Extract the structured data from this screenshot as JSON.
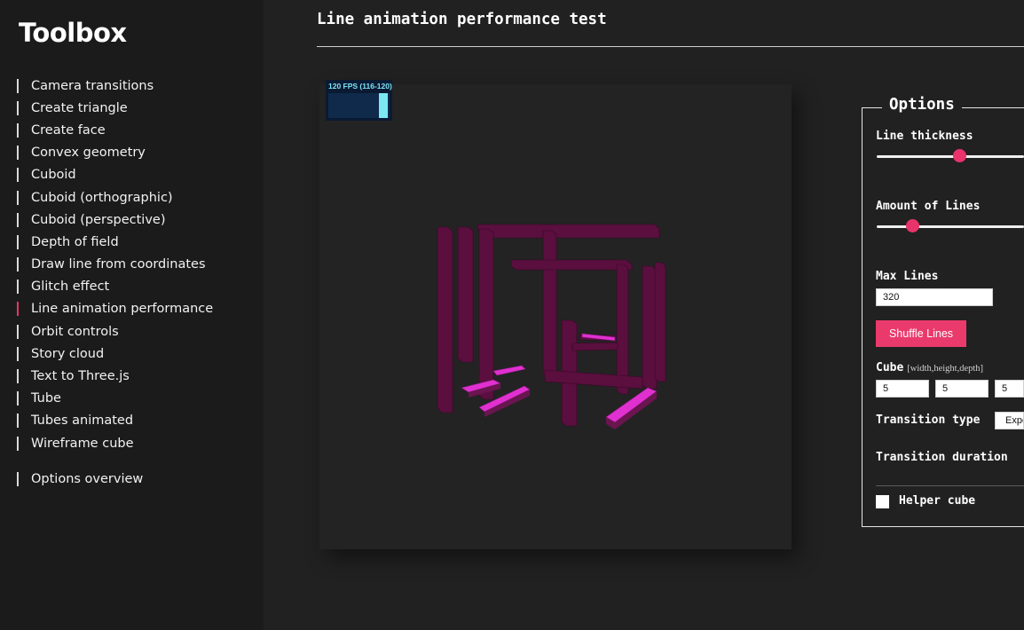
{
  "sidebar": {
    "brand": "Toolbox",
    "items": [
      {
        "label": "Camera transitions"
      },
      {
        "label": "Create triangle"
      },
      {
        "label": "Create face"
      },
      {
        "label": "Convex geometry"
      },
      {
        "label": "Cuboid"
      },
      {
        "label": "Cuboid (orthographic)"
      },
      {
        "label": "Cuboid (perspective)"
      },
      {
        "label": "Depth of field"
      },
      {
        "label": "Draw line from coordinates"
      },
      {
        "label": "Glitch effect"
      },
      {
        "label": "Line animation performance",
        "active": true
      },
      {
        "label": "Orbit controls"
      },
      {
        "label": "Story cloud"
      },
      {
        "label": "Text to Three.js"
      },
      {
        "label": "Tube"
      },
      {
        "label": "Tubes animated"
      },
      {
        "label": "Wireframe cube"
      }
    ],
    "extra_item": "Options overview"
  },
  "header": {
    "title": "Line animation performance test"
  },
  "stats": {
    "fps_label": "120 FPS (116-120)",
    "fps_fraction": 1.0
  },
  "options": {
    "legend": "Options",
    "line_thickness": {
      "label": "Line thickness",
      "value_fraction": 0.55
    },
    "amount_of_lines": {
      "label": "Amount of Lines",
      "value_fraction": 0.24
    },
    "max_lines": {
      "label": "Max Lines",
      "value": "320"
    },
    "shuffle_button": "Shuffle Lines",
    "cube": {
      "label": "Cube",
      "hint": "[width,height,depth]",
      "width": "5",
      "height": "5",
      "depth": "5"
    },
    "transition_type": {
      "label": "Transition type",
      "value": "Expo"
    },
    "transition_duration": {
      "label": "Transition duration"
    },
    "helper_cube": {
      "label": "Helper cube",
      "checked": false
    }
  },
  "colors": {
    "accent": "#e8336b",
    "line_dark": "#5a0f3e",
    "line_bright": "#e030d0"
  }
}
